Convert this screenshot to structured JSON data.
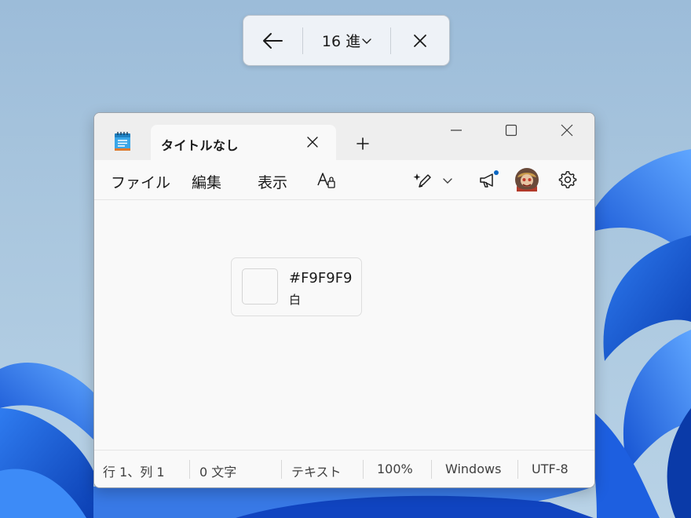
{
  "color_picker": {
    "format_label": "16 進",
    "icons": {
      "back": "arrow-left-icon",
      "dropdown": "chevron-down-icon",
      "close": "close-icon"
    }
  },
  "window": {
    "tab_title": "タイトルなし",
    "icons": {
      "app": "notepad-icon",
      "tab_close": "close-icon",
      "new_tab": "plus-icon",
      "minimize": "minimize-icon",
      "maximize": "maximize-icon",
      "close": "close-icon"
    }
  },
  "menu": {
    "items": [
      "ファイル",
      "編集",
      "表示"
    ],
    "icons": {
      "font": "font-icon",
      "copilot": "pen-sparkle-icon",
      "copilot_dropdown": "chevron-down-icon",
      "announcement": "megaphone-icon",
      "account": "avatar",
      "settings": "gear-icon"
    }
  },
  "color_card": {
    "hex": "#F9F9F9",
    "name": "白",
    "swatch_color": "#F9F9F9"
  },
  "status": {
    "position": "行 1、列 1",
    "chars": "0 文字",
    "mode": "テキスト",
    "zoom": "100%",
    "line_ending": "Windows",
    "encoding": "UTF-8"
  },
  "colors": {
    "accent": "#0067c0",
    "notification_dot": "#0a66c2"
  }
}
